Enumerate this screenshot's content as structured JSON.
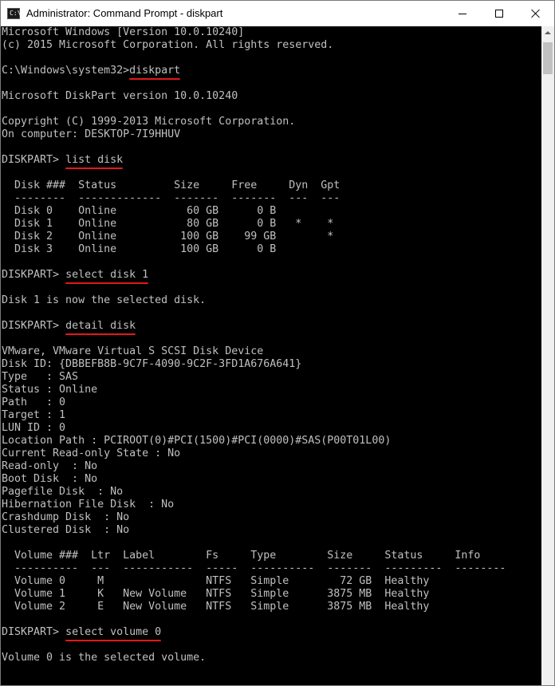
{
  "window": {
    "title": "Administrator: Command Prompt - diskpart",
    "icon": "cmd-icon",
    "icon_glyph": "C:\\",
    "controls": [
      "minimize-icon",
      "maximize-icon",
      "close-icon"
    ]
  },
  "console": {
    "lines": [
      {
        "text": "Microsoft Windows [Version 10.0.10240]"
      },
      {
        "text": "(c) 2015 Microsoft Corporation. All rights reserved."
      },
      {
        "text": ""
      },
      {
        "prefix": "C:\\Windows\\system32>",
        "cmd": "diskpart"
      },
      {
        "text": ""
      },
      {
        "text": "Microsoft DiskPart version 10.0.10240"
      },
      {
        "text": ""
      },
      {
        "text": "Copyright (C) 1999-2013 Microsoft Corporation."
      },
      {
        "text": "On computer: DESKTOP-7I9HHUV"
      },
      {
        "text": ""
      },
      {
        "prefix": "DISKPART> ",
        "cmd": "list disk"
      },
      {
        "text": ""
      },
      {
        "text": "  Disk ###  Status         Size     Free     Dyn  Gpt"
      },
      {
        "text": "  --------  -------------  -------  -------  ---  ---"
      },
      {
        "text": "  Disk 0    Online           60 GB      0 B"
      },
      {
        "text": "  Disk 1    Online           80 GB      0 B   *    *"
      },
      {
        "text": "  Disk 2    Online          100 GB    99 GB        *"
      },
      {
        "text": "  Disk 3    Online          100 GB      0 B"
      },
      {
        "text": ""
      },
      {
        "prefix": "DISKPART> ",
        "cmd": "select disk 1"
      },
      {
        "text": ""
      },
      {
        "text": "Disk 1 is now the selected disk."
      },
      {
        "text": ""
      },
      {
        "prefix": "DISKPART> ",
        "cmd": "detail disk"
      },
      {
        "text": ""
      },
      {
        "text": "VMware, VMware Virtual S SCSI Disk Device"
      },
      {
        "text": "Disk ID: {DBBEFB8B-9C7F-4090-9C2F-3FD1A676A641}"
      },
      {
        "text": "Type   : SAS"
      },
      {
        "text": "Status : Online"
      },
      {
        "text": "Path   : 0"
      },
      {
        "text": "Target : 1"
      },
      {
        "text": "LUN ID : 0"
      },
      {
        "text": "Location Path : PCIROOT(0)#PCI(1500)#PCI(0000)#SAS(P00T01L00)"
      },
      {
        "text": "Current Read-only State : No"
      },
      {
        "text": "Read-only  : No"
      },
      {
        "text": "Boot Disk  : No"
      },
      {
        "text": "Pagefile Disk  : No"
      },
      {
        "text": "Hibernation File Disk  : No"
      },
      {
        "text": "Crashdump Disk  : No"
      },
      {
        "text": "Clustered Disk  : No"
      },
      {
        "text": ""
      },
      {
        "text": "  Volume ###  Ltr  Label        Fs     Type        Size     Status     Info"
      },
      {
        "text": "  ----------  ---  -----------  -----  ----------  -------  ---------  --------"
      },
      {
        "text": "  Volume 0     M                NTFS   Simple        72 GB  Healthy"
      },
      {
        "text": "  Volume 1     K   New Volume   NTFS   Simple      3875 MB  Healthy"
      },
      {
        "text": "  Volume 2     E   New Volume   NTFS   Simple      3875 MB  Healthy"
      },
      {
        "text": ""
      },
      {
        "prefix": "DISKPART> ",
        "cmd": "select volume 0"
      },
      {
        "text": ""
      },
      {
        "text": "Volume 0 is the selected volume."
      }
    ]
  },
  "colors": {
    "console_bg": "#000000",
    "console_fg": "#c0c0c0",
    "annotation_underline": "#e3181b"
  }
}
